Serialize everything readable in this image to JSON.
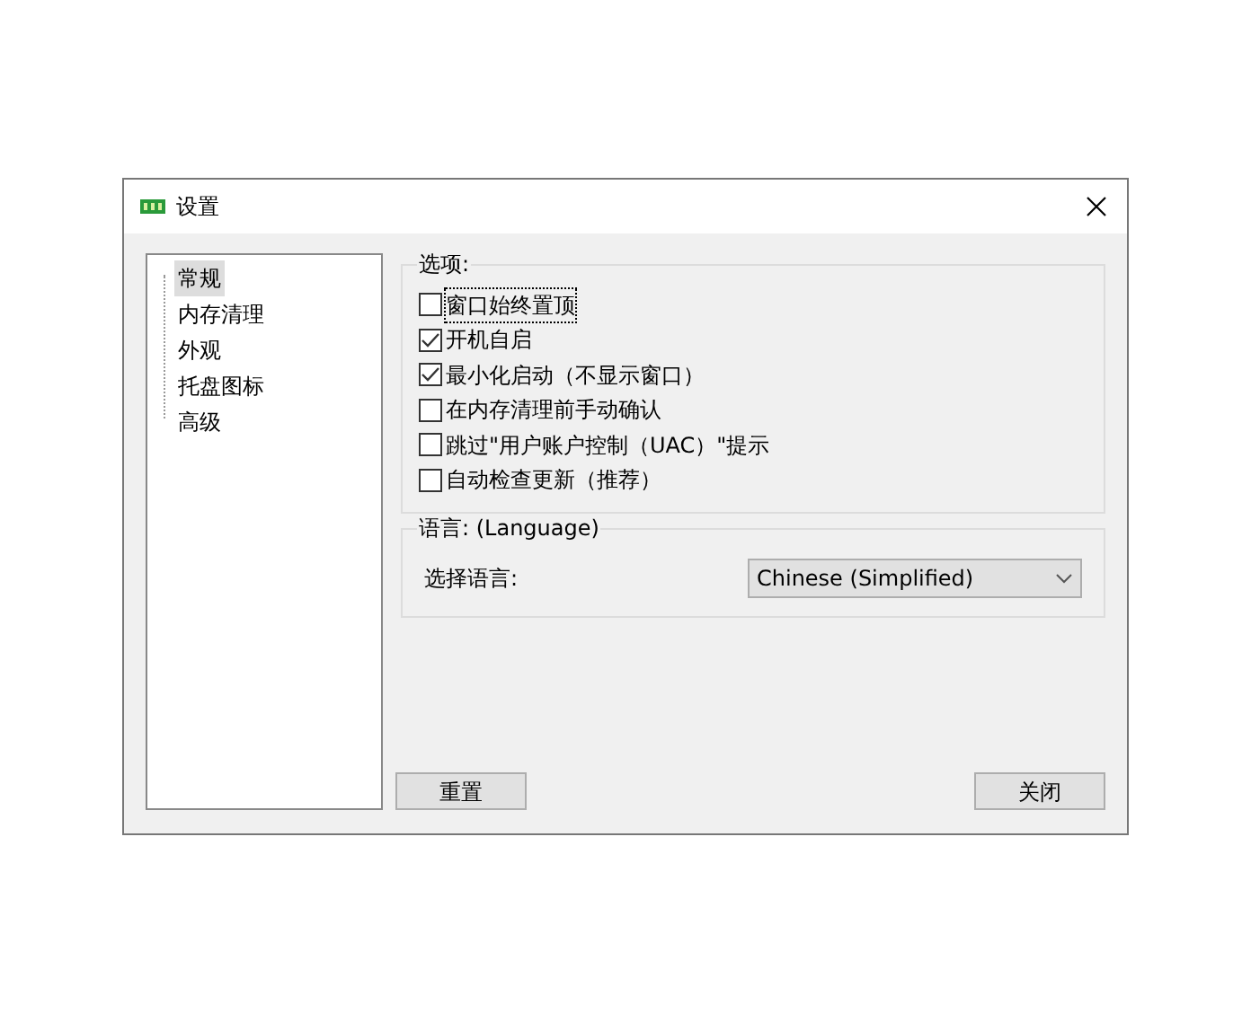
{
  "window": {
    "title": "设置"
  },
  "sidebar": {
    "items": [
      {
        "label": "常规",
        "selected": true
      },
      {
        "label": "内存清理",
        "selected": false
      },
      {
        "label": "外观",
        "selected": false
      },
      {
        "label": "托盘图标",
        "selected": false
      },
      {
        "label": "高级",
        "selected": false
      }
    ]
  },
  "options": {
    "title": "选项:",
    "items": [
      {
        "label": "窗口始终置顶",
        "checked": false,
        "focused": true
      },
      {
        "label": "开机自启",
        "checked": true,
        "focused": false
      },
      {
        "label": "最小化启动（不显示窗口）",
        "checked": true,
        "focused": false
      },
      {
        "label": "在内存清理前手动确认",
        "checked": false,
        "focused": false
      },
      {
        "label": "跳过\"用户账户控制（UAC）\"提示",
        "checked": false,
        "focused": false
      },
      {
        "label": "自动检查更新（推荐）",
        "checked": false,
        "focused": false
      }
    ]
  },
  "language": {
    "title": "语言: (Language)",
    "label": "选择语言:",
    "value": "Chinese (Simplified)"
  },
  "buttons": [
    {
      "label": "重置"
    },
    {
      "label": "关闭"
    }
  ]
}
